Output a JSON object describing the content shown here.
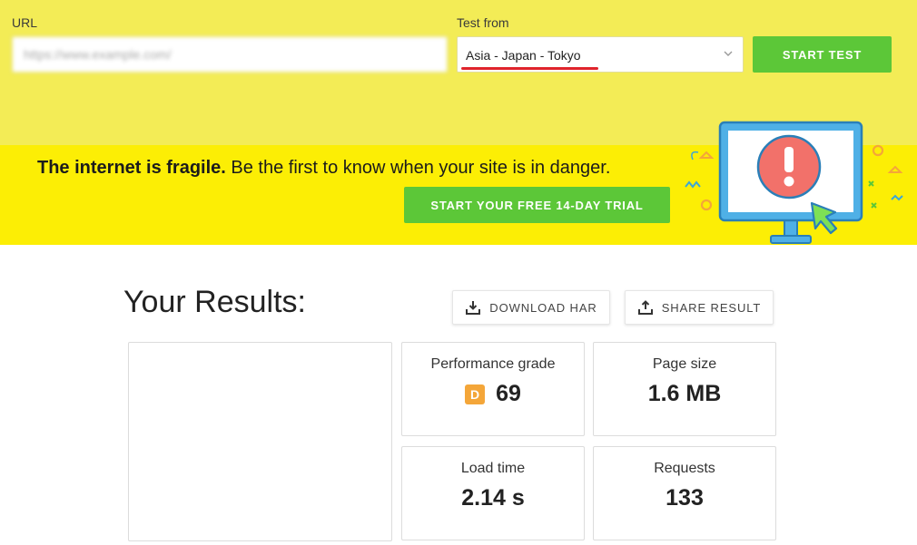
{
  "search": {
    "url_label": "URL",
    "url_value": "https://www.example.com/",
    "from_label": "Test from",
    "location_value": "Asia - Japan - Tokyo",
    "start_label": "START TEST"
  },
  "promo": {
    "strong_text": "The internet is fragile.",
    "text": " Be the first to know when your site is in danger.",
    "trial_label": "START YOUR FREE 14-DAY TRIAL"
  },
  "results": {
    "title": "Your Results:",
    "download_label": "DOWNLOAD HAR",
    "share_label": "SHARE RESULT",
    "metrics": [
      {
        "label": "Performance grade",
        "grade": "D",
        "value": "69"
      },
      {
        "label": "Page size",
        "value": "1.6 MB"
      },
      {
        "label": "Load time",
        "value": "2.14 s"
      },
      {
        "label": "Requests",
        "value": "133"
      }
    ]
  },
  "colors": {
    "top_band": "#f3ec56",
    "promo_band": "#fcee05",
    "accent_green": "#5cc738",
    "highlight_red": "#e0242c",
    "grade_badge": "#f4a639"
  },
  "icons": [
    "chevron-down-icon",
    "download-icon",
    "share-icon",
    "alert-monitor-illustration"
  ]
}
